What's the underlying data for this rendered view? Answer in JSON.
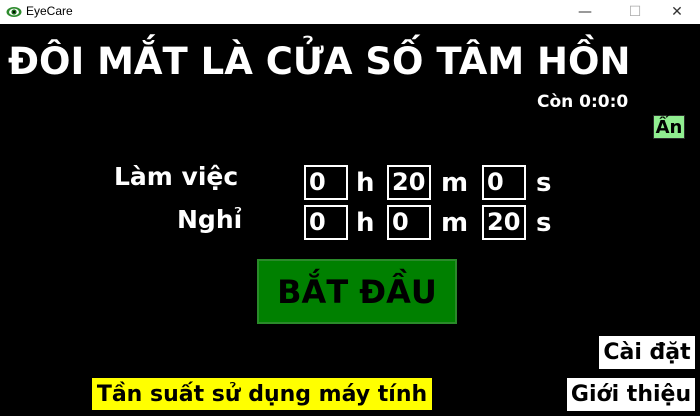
{
  "window": {
    "title": "EyeCare",
    "minimize_glyph": "—",
    "maximize_glyph": "☐",
    "close_glyph": "✕"
  },
  "main": {
    "headline": "ĐÔI MẮT LÀ CỬA SỐ TÂM HỒN",
    "countdown": "Còn 0:0:0",
    "hide_label": "Ẩn",
    "work": {
      "label": "Làm việc",
      "hours": "0",
      "minutes": "20",
      "seconds": "0"
    },
    "rest": {
      "label": "Nghỉ",
      "hours": "0",
      "minutes": "0",
      "seconds": "20"
    },
    "units": {
      "h": "h",
      "m": "m",
      "s": "s"
    },
    "start_label": "BẮT ĐẦU",
    "settings_label": "Cài đặt",
    "about_label": "Giới thiệu",
    "frequency_label": "Tần suất sử dụng máy tính"
  },
  "colors": {
    "background": "#000000",
    "start_button": "#008000",
    "hide_button": "#90ee90",
    "frequency_button": "#ffff00"
  }
}
